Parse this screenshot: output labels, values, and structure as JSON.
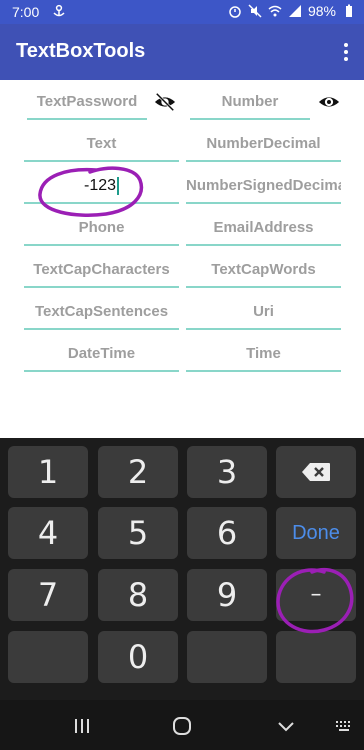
{
  "status_bar": {
    "time": "7:00",
    "battery": "98%",
    "icons": [
      "notification-icon",
      "alarm-icon",
      "mute-icon",
      "wifi-icon",
      "signal-icon",
      "battery-icon"
    ]
  },
  "app_bar": {
    "title": "TextBoxTools",
    "menu_icon": "more-vert-icon"
  },
  "fields": {
    "text_password": {
      "placeholder": "TextPassword",
      "icon": "eye-off-icon"
    },
    "number": {
      "placeholder": "Number",
      "icon": "eye-icon"
    },
    "text": {
      "placeholder": "Text"
    },
    "number_decimal": {
      "placeholder": "NumberDecimal"
    },
    "signed_value": {
      "value": "-123"
    },
    "number_signed_decimal": {
      "placeholder": "NumberSignedDecima"
    },
    "phone": {
      "placeholder": "Phone"
    },
    "email": {
      "placeholder": "EmailAddress"
    },
    "cap_chars": {
      "placeholder": "TextCapCharacters"
    },
    "cap_words": {
      "placeholder": "TextCapWords"
    },
    "cap_sentences": {
      "placeholder": "TextCapSentences"
    },
    "uri": {
      "placeholder": "Uri"
    },
    "datetime": {
      "placeholder": "DateTime"
    },
    "time": {
      "placeholder": "Time"
    }
  },
  "keyboard": {
    "keys": [
      "1",
      "2",
      "3",
      "4",
      "5",
      "6",
      "7",
      "8",
      "9",
      "0",
      "–"
    ],
    "done_label": "Done",
    "backspace_icon": "backspace-icon",
    "annotation_color": "#9b1fb5"
  },
  "nav_bar": {
    "icons": [
      "recents-icon",
      "home-icon",
      "back-icon",
      "keyboard-icon"
    ]
  }
}
